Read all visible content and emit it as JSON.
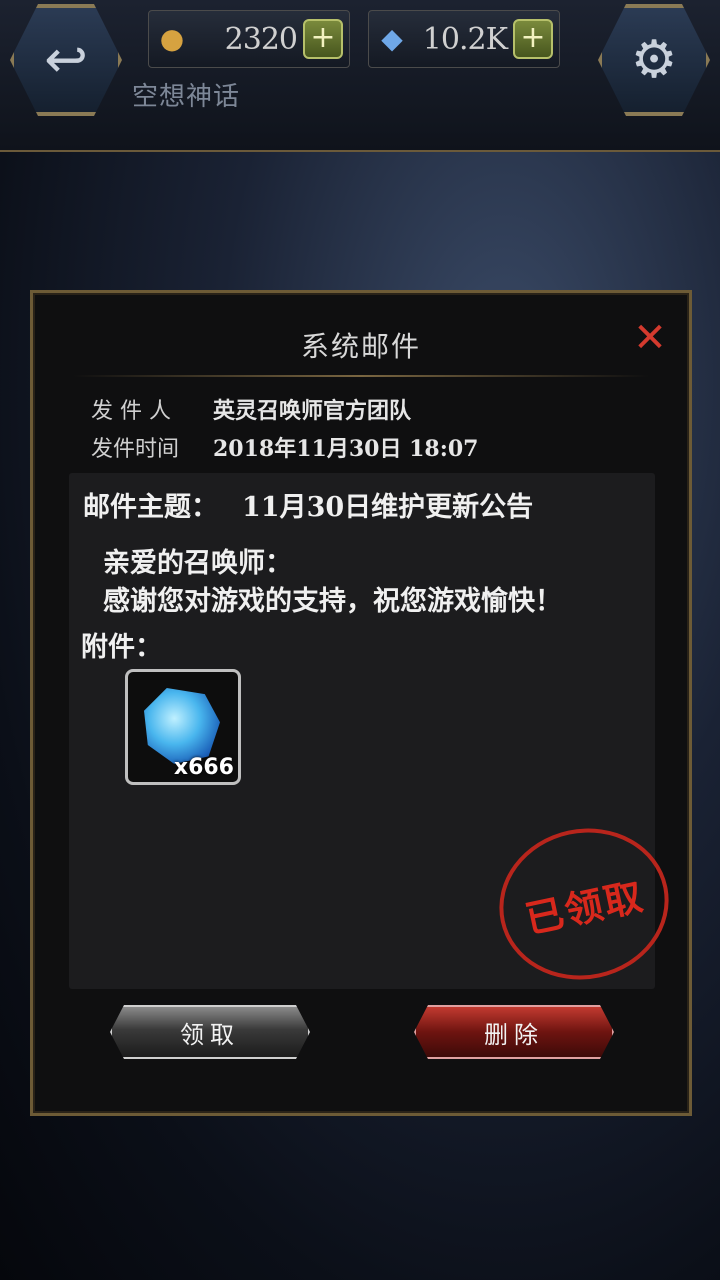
{
  "topbar": {
    "gold": "2320",
    "gems": "10.2K",
    "subtitle": "空想神话",
    "icons": {
      "back": "back-arrow-icon",
      "settings": "gear-icon",
      "coin": "coin-icon",
      "gem": "gem-icon"
    }
  },
  "dialog": {
    "title": "系统邮件",
    "close_icon": "close-icon",
    "sender_label": "发 件 人",
    "sender": "英灵召唤师官方团队",
    "time_label": "发件时间",
    "time": "2018年11月30日  18:07",
    "subject_label": "邮件主题：",
    "subject": "11月30日维护更新公告",
    "body_line1": "亲爱的召唤师：",
    "body_line2": "感谢您对游戏的支持，祝您游戏愉快！",
    "attachments_label": "附件：",
    "attachment": {
      "name": "crystal-gem",
      "quantity": "x666"
    },
    "stamp_text": "已领取",
    "claim_label": "领取",
    "delete_label": "删除"
  },
  "colors": {
    "accent_gold": "#6d5b36",
    "delete_red": "#c23a30",
    "stamp_red": "#d8281c"
  }
}
